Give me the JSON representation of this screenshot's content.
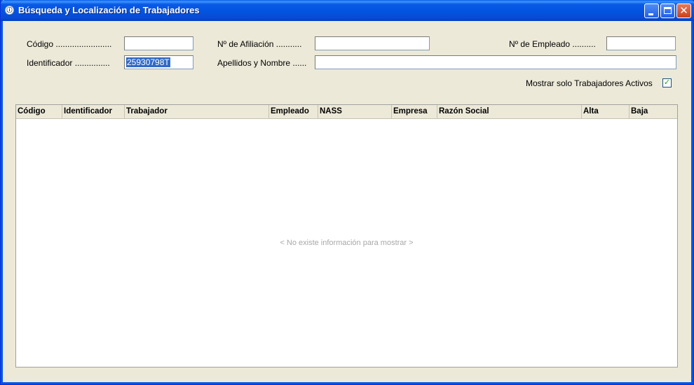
{
  "window": {
    "title": "Búsqueda y Localización de Trabajadores",
    "icon": "app-icon",
    "title_color": "#ffffff",
    "titlebar_color": "#0254e0"
  },
  "form": {
    "codigo_label": "Código ........................",
    "codigo_value": "",
    "identificador_label": "Identificador ...............",
    "identificador_value": "25930798T",
    "afiliacion_label": "Nº de Afiliación ...........",
    "afiliacion_value": "",
    "apellidos_label": "Apellidos y Nombre ......",
    "apellidos_value": "",
    "empleado_label": "Nº de Empleado ..........",
    "empleado_value": "",
    "activos_label": "Mostrar solo Trabajadores Activos",
    "activos_checked": true
  },
  "grid": {
    "columns": [
      "Código",
      "Identificador",
      "Trabajador",
      "Empleado",
      "NASS",
      "Empresa",
      "Razón Social",
      "Alta",
      "Baja"
    ],
    "empty_message": "< No existe información para mostrar >",
    "rows": []
  }
}
